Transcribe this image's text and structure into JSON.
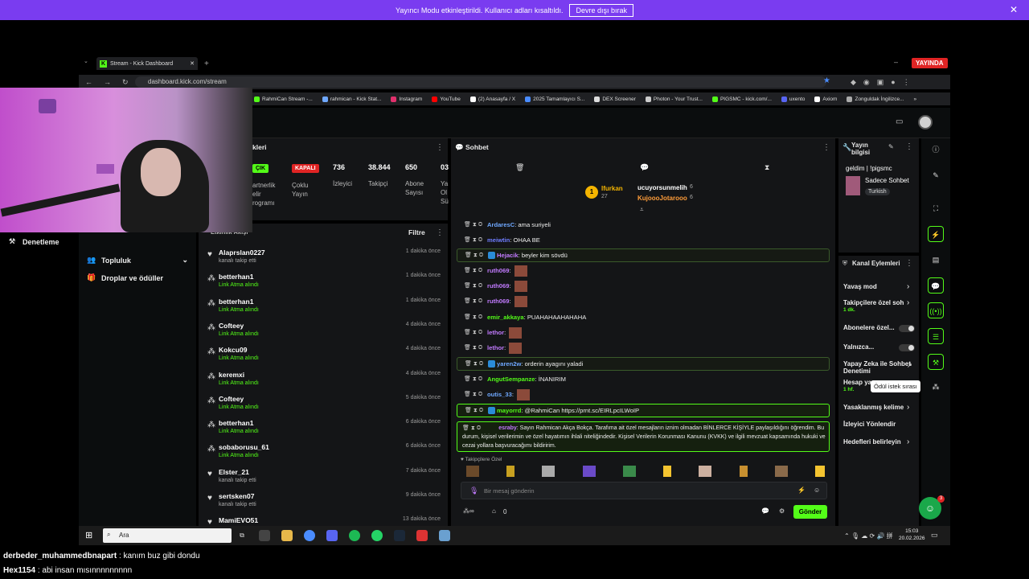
{
  "banner": {
    "text": "Yayıncı Modu etkinleştirildi. Kullanıcı adları kısaltıldı.",
    "button": "Devre dışı bırak"
  },
  "live_badge": "YAYINDA",
  "browser": {
    "tab_title": "Stream - Kick Dashboard",
    "url": "dashboard.kick.com/stream",
    "bookmarks": [
      "RahmiCan Stream -...",
      "rahmican - Kick Stat...",
      "Instagram",
      "YouTube",
      "(2) Anasayfa / X",
      "2025 Tamamlayıcı S...",
      "DEX Screener",
      "Photon - Your Trust...",
      "PIGSMC - kick.com/...",
      "uxento",
      "Axiom",
      "Zonguldak İngilizce..."
    ]
  },
  "sidebar": {
    "items": [
      {
        "label": "Denetleme",
        "icon": "hammer-icon"
      },
      {
        "label": "Topluluk",
        "icon": "users-icon"
      },
      {
        "label": "Droplar ve ödüller",
        "icon": "gift-icon"
      }
    ]
  },
  "stream_info": {
    "title_partial": "kleri",
    "badge_open": "ÇIK",
    "badge_closed": "KAPALI",
    "labels": [
      "artnerlik\nelir\nrogramı",
      "Çoklu\nYayın"
    ],
    "stats": [
      {
        "value": "736",
        "label": "İzleyici"
      },
      {
        "value": "38.844",
        "label": "Takipçi"
      },
      {
        "value": "650",
        "label": "Abone\nSayısı"
      },
      {
        "value": "03",
        "label": "Ya\nOl\nSü"
      }
    ]
  },
  "activity": {
    "title": "Etkinlik Akışı",
    "filter_label": "Filtre",
    "items": [
      {
        "name": "Alaprslan0227",
        "desc": "kanalı takip etti",
        "time": "1 dakika önce",
        "type": "follow"
      },
      {
        "name": "betterhan1",
        "desc": "Link Atma alındı",
        "time": "1 dakika önce",
        "type": "reward"
      },
      {
        "name": "betterhan1",
        "desc": "Link Atma alındı",
        "time": "1 dakika önce",
        "type": "reward"
      },
      {
        "name": "Cofteey",
        "desc": "Link Atma alındı",
        "time": "4 dakika önce",
        "type": "reward"
      },
      {
        "name": "Kokcu09",
        "desc": "Link Atma alındı",
        "time": "4 dakika önce",
        "type": "reward"
      },
      {
        "name": "keremxi",
        "desc": "Link Atma alındı",
        "time": "4 dakika önce",
        "type": "reward"
      },
      {
        "name": "Cofteey",
        "desc": "Link Atma alındı",
        "time": "5 dakika önce",
        "type": "reward"
      },
      {
        "name": "betterhan1",
        "desc": "Link Atma alındı",
        "time": "6 dakika önce",
        "type": "reward"
      },
      {
        "name": "sobaborusu_61",
        "desc": "Link Atma alındı",
        "time": "6 dakika önce",
        "type": "reward"
      },
      {
        "name": "Elster_21",
        "desc": "kanalı takip etti",
        "time": "7 dakika önce",
        "type": "follow"
      },
      {
        "name": "sertsken07",
        "desc": "kanalı takip etti",
        "time": "9 dakika önce",
        "type": "follow"
      },
      {
        "name": "MamiEVO51",
        "desc": "",
        "time": "13 dakika önce",
        "type": "follow"
      }
    ]
  },
  "chat": {
    "title": "Sohbet",
    "leaderboard": {
      "first_name": "Ifurkan",
      "first_count": "27",
      "second": [
        {
          "name": "ucuyorsunmelih",
          "count": "6"
        },
        {
          "name": "KujoooJotarooo",
          "count": "6"
        }
      ]
    },
    "messages": [
      {
        "user": "ArdaresC",
        "text": "ama suriyeli",
        "color": "#6fa8ff",
        "hl": ""
      },
      {
        "user": "meiwtin",
        "text": "OHAA BE",
        "color": "#6f7dff",
        "hl": ""
      },
      {
        "user": "Hejacik",
        "text": "beyler kim sövdü",
        "color": "#c27bff",
        "hl": "hl2"
      },
      {
        "user": "ruth069",
        "text": "",
        "color": "#c27bff",
        "hl": "",
        "emote": true
      },
      {
        "user": "ruth069",
        "text": "",
        "color": "#c27bff",
        "hl": "",
        "emote": true
      },
      {
        "user": "ruth069",
        "text": "",
        "color": "#c27bff",
        "hl": "",
        "emote": true
      },
      {
        "user": "emir_akkaya",
        "text": "PUAHAHAAHAHAHA",
        "color": "#53fc18",
        "hl": ""
      },
      {
        "user": "lethor",
        "text": "",
        "color": "#c27bff",
        "hl": "",
        "emote": true
      },
      {
        "user": "lethor",
        "text": "",
        "color": "#c27bff",
        "hl": "",
        "emote": true
      },
      {
        "user": "yaren2w",
        "text": "orderin ayagını yaladi",
        "color": "#6fa8ff",
        "hl": "hl2"
      },
      {
        "user": "AngutSempanze",
        "text": "İNANIRIM",
        "color": "#53fc18",
        "hl": ""
      },
      {
        "user": "outis_33",
        "text": "",
        "color": "#6fa8ff",
        "hl": "",
        "emote": true
      },
      {
        "user": "mayorrd",
        "text": "@RahmiCan https://prnt.sc/EIRLpcILWoIP",
        "color": "#53fc18",
        "hl": "hl"
      }
    ],
    "long_message": {
      "user": "esraby",
      "text": "Sayın Rahmican Akça Bokça. Tarafıma ait özel mesajların iznim olmadan BİNLERCE KİŞİYLE paylaşıldığını öğrendim. Bu durum, kişisel verilerimin ve özel hayatımın ihlali niteliğindedir. Kişisel Verilerin Korunması Kanunu (KVKK) ve ilgili mevzuat kapsamında hukuki ve cezai yollara başvuracağımı bildiririm."
    },
    "followers_only_label": "Takipçilere Özel",
    "input_placeholder": "Bir mesaj gönderin",
    "points": "0",
    "send_label": "Gönder"
  },
  "stream_summary": {
    "title": "Yayın bilgisi",
    "stream_title": "geldim | !pigsmc",
    "category": "Sadece Sohbet",
    "language": "Turkish"
  },
  "channel_actions": {
    "title": "Kanal Eylemleri",
    "items": [
      {
        "label": "Yavaş mod",
        "sub": "",
        "control": "chevron"
      },
      {
        "label": "Takipçilere özel soh",
        "sub": "1 dk.",
        "control": "chevron"
      },
      {
        "label": "Abonelere özel...",
        "sub": "",
        "control": "toggle"
      },
      {
        "label": "Yalnızca...",
        "sub": "",
        "control": "toggle"
      },
      {
        "label": "Yapay Zeka ile Sohbet Denetimi",
        "sub": "",
        "control": "link"
      },
      {
        "label": "Hesap ya",
        "sub": "1 hf.",
        "control": "chevron"
      },
      {
        "label": "Yasaklanmış kelime",
        "sub": "",
        "control": "chevron"
      },
      {
        "label": "İzleyici Yönlendir",
        "sub": "",
        "control": "none"
      },
      {
        "label": "Hedefleri belirleyin",
        "sub": "",
        "control": "chevron"
      }
    ],
    "tooltip": "Ödül istek sırası"
  },
  "taskbar": {
    "search_placeholder": "Ara",
    "time": "15:03",
    "date": "20.02.2026",
    "badge": "3"
  },
  "overlay_chat": [
    {
      "user": "derbeder_muhammedbnapart",
      "text": ": kanım buz gibi dondu"
    },
    {
      "user": "Hex1154",
      "text": ": abi insan mısınnnnnnnnn"
    }
  ],
  "colors": {
    "accent": "#53fc18",
    "banner": "#7a3cf0",
    "live": "#e02424",
    "panel": "#141517",
    "bg": "#0b0d0e"
  }
}
